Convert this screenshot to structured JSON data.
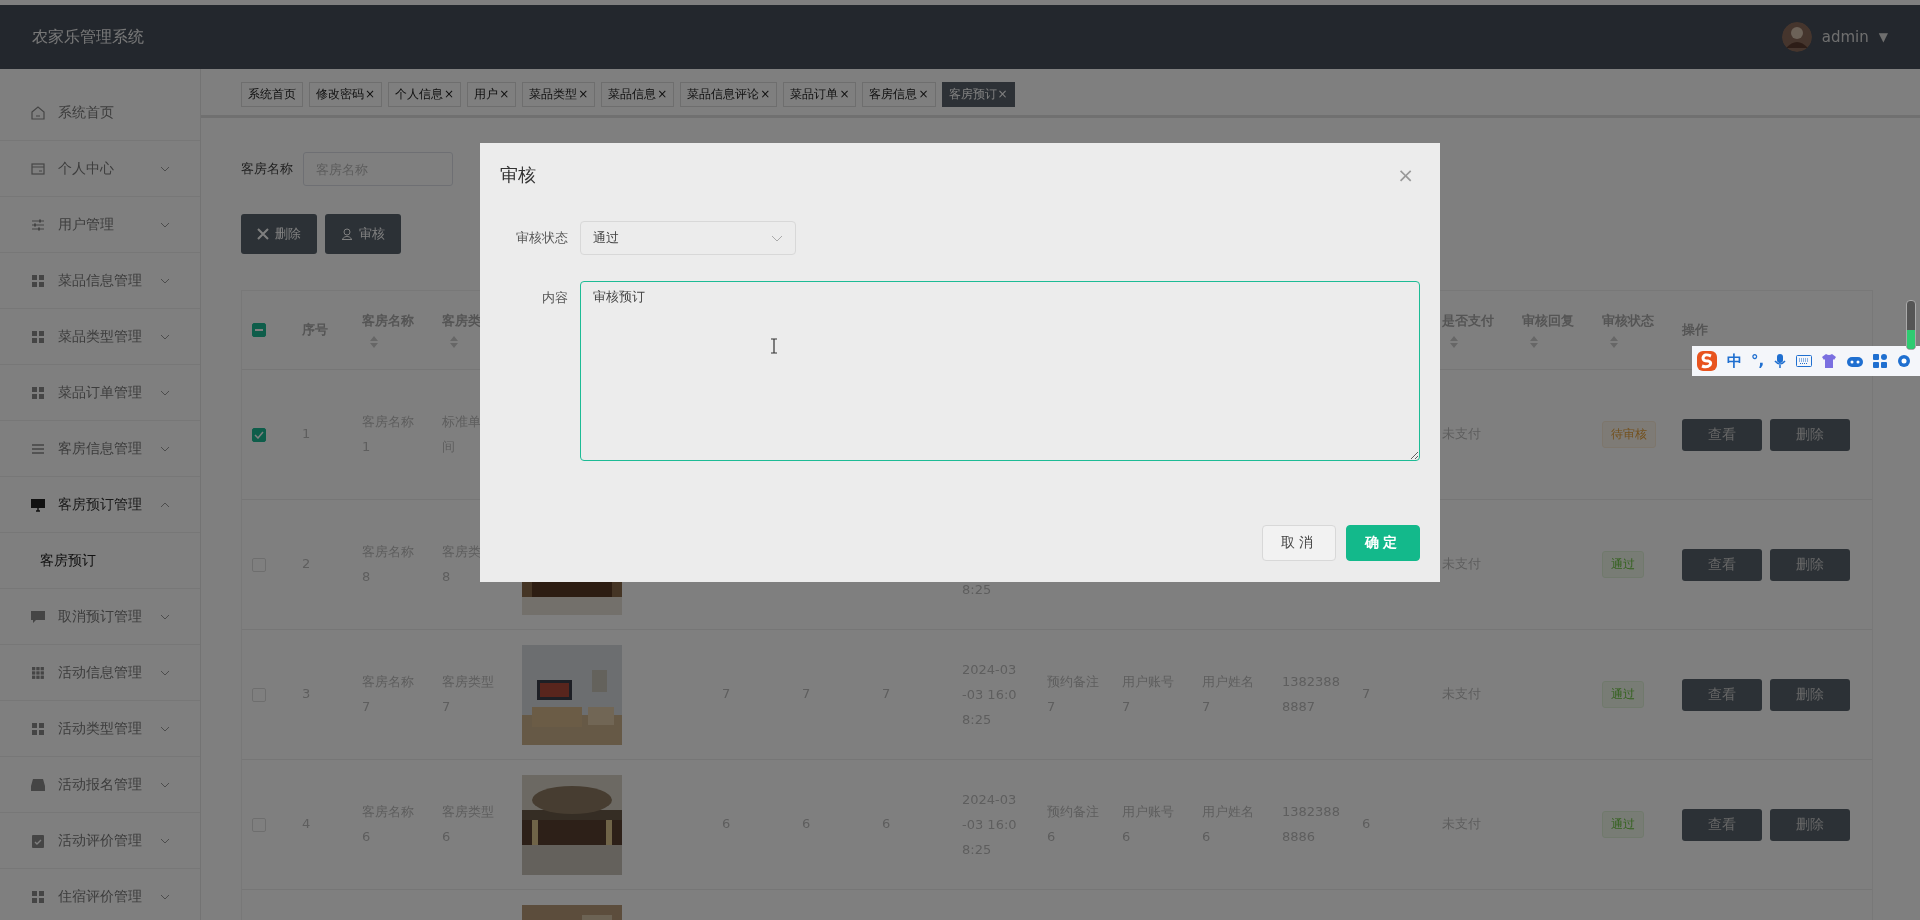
{
  "header": {
    "title": "农家乐管理系统",
    "user": "admin",
    "caret": "▼"
  },
  "sidebar": [
    {
      "label": "系统首页",
      "expanded": false,
      "has_children": false
    },
    {
      "label": "个人中心",
      "expanded": false,
      "has_children": true
    },
    {
      "label": "用户管理",
      "expanded": false,
      "has_children": true
    },
    {
      "label": "菜品信息管理",
      "expanded": false,
      "has_children": true
    },
    {
      "label": "菜品类型管理",
      "expanded": false,
      "has_children": true
    },
    {
      "label": "菜品订单管理",
      "expanded": false,
      "has_children": true
    },
    {
      "label": "客房信息管理",
      "expanded": false,
      "has_children": true
    },
    {
      "label": "客房预订管理",
      "expanded": true,
      "has_children": true,
      "children": [
        {
          "label": "客房预订",
          "selected": true
        }
      ]
    },
    {
      "label": "取消预订管理",
      "expanded": false,
      "has_children": true
    },
    {
      "label": "活动信息管理",
      "expanded": false,
      "has_children": true
    },
    {
      "label": "活动类型管理",
      "expanded": false,
      "has_children": true
    },
    {
      "label": "活动报名管理",
      "expanded": false,
      "has_children": true
    },
    {
      "label": "活动评价管理",
      "expanded": false,
      "has_children": true
    },
    {
      "label": "住宿评价管理",
      "expanded": false,
      "has_children": true
    }
  ],
  "tabs": [
    {
      "label": "系统首页",
      "selected": false
    },
    {
      "label": "修改密码",
      "selected": false,
      "close": "×"
    },
    {
      "label": "个人信息",
      "selected": false,
      "close": "×"
    },
    {
      "label": "用户",
      "selected": false,
      "close": "×"
    },
    {
      "label": "菜品类型",
      "selected": false,
      "close": "×"
    },
    {
      "label": "菜品信息",
      "selected": false,
      "close": "×"
    },
    {
      "label": "菜品信息评论",
      "selected": false,
      "close": "×"
    },
    {
      "label": "菜品订单",
      "selected": false,
      "close": "×"
    },
    {
      "label": "客房信息",
      "selected": false,
      "close": "×"
    },
    {
      "label": "客房预订",
      "selected": true,
      "close": "×"
    }
  ],
  "search": {
    "label": "客房名称",
    "placeholder": "客房名称"
  },
  "actions": [
    {
      "label": "删除",
      "kind": "delete"
    },
    {
      "label": "审核",
      "kind": "review"
    }
  ],
  "table": {
    "select_all_indeterminate": true,
    "columns": [
      {
        "label": "序号",
        "sortable": false
      },
      {
        "label": "客房名称",
        "sortable": true
      },
      {
        "label": "客房类",
        "sortable": true
      },
      {
        "label": "是否支付",
        "sortable": true
      },
      {
        "label": "审核回复",
        "sortable": true
      },
      {
        "label": "审核状态",
        "sortable": true
      },
      {
        "label": "操作",
        "sortable": false
      }
    ],
    "rows": [
      {
        "selected": true,
        "index": "1",
        "name": [
          "客房名称",
          "1"
        ],
        "type": [
          "标准单",
          "间"
        ],
        "pay": "未支付",
        "status": {
          "text": "待审核",
          "kind": "pending"
        },
        "ops": [
          "查看",
          "删除"
        ]
      },
      {
        "selected": false,
        "index": "2",
        "name": [
          "客房名称",
          "8"
        ],
        "type": [
          "客房类",
          "8"
        ],
        "column_5": {
          "kind": "picture"
        },
        "column_9": [
          "8:25"
        ],
        "pay": "未支付",
        "status": {
          "text": "通过",
          "kind": "approved"
        },
        "ops": [
          "查看",
          "删除"
        ]
      },
      {
        "selected": false,
        "index": "3",
        "name": [
          "客房名称",
          "7"
        ],
        "type": [
          "客房类型",
          "7"
        ],
        "column_5": {
          "kind": "picture"
        },
        "column_6": "7",
        "column_7": "7",
        "column_8": "7",
        "column_9": [
          "2024-03",
          "-03 16:0",
          "8:25"
        ],
        "column_10": [
          "预约备注",
          "7"
        ],
        "column_11": [
          "用户账号",
          "7"
        ],
        "column_12": [
          "用户姓名",
          "7"
        ],
        "column_13": [
          "1382388",
          "8887"
        ],
        "column_14": "7",
        "pay": "未支付",
        "status": {
          "text": "通过",
          "kind": "approved"
        },
        "ops": [
          "查看",
          "删除"
        ]
      },
      {
        "selected": false,
        "index": "4",
        "name": [
          "客房名称",
          "6"
        ],
        "type": [
          "客房类型",
          "6"
        ],
        "column_5": {
          "kind": "picture"
        },
        "column_6": "6",
        "column_7": "6",
        "column_8": "6",
        "column_9": [
          "2024-03",
          "-03 16:0",
          "8:25"
        ],
        "column_10": [
          "预约备注",
          "6"
        ],
        "column_11": [
          "用户账号",
          "6"
        ],
        "column_12": [
          "用户姓名",
          "6"
        ],
        "column_13": [
          "1382388",
          "8886"
        ],
        "column_14": "6",
        "pay": "未支付",
        "status": {
          "text": "通过",
          "kind": "approved"
        },
        "ops": [
          "查看",
          "删除"
        ]
      },
      {
        "column_5": {
          "kind": "picture"
        }
      }
    ]
  },
  "dialog": {
    "title": "审核",
    "close": "×",
    "status_label": "审核状态",
    "status_value": "通过",
    "content_label": "内容",
    "content_value": "审核预订",
    "buttons": [
      {
        "label": "取消",
        "kind": "default"
      },
      {
        "label": "确定",
        "kind": "primary"
      }
    ]
  },
  "ime": {
    "mode": "中",
    "punct": "°,"
  }
}
